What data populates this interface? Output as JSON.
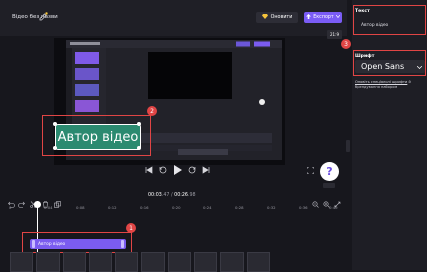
{
  "header": {
    "project_title": "Відео без назви",
    "upgrade_label": "Оновити",
    "export_label": "Експорт"
  },
  "stage": {
    "aspect_ratio": "21:9",
    "overlay_text": "Автор відео"
  },
  "playback": {
    "current_time": "00:03",
    "current_fraction": ".47",
    "separator": " / ",
    "total_time": "00:26",
    "total_fraction": ".98"
  },
  "ruler": {
    "ticks": [
      "0",
      "0:04",
      "0:08",
      "0:12",
      "0:16",
      "0:20",
      "0:24",
      "0:28",
      "0:32",
      "0:36",
      "0:40"
    ]
  },
  "timeline": {
    "clip_label": "Автор відео"
  },
  "sidebar": {
    "text_section_title": "Текст",
    "text_value": "Автор відео",
    "font_section_title": "Шрифт",
    "font_value": "Open Sans",
    "hint_link": "Оновіть спеціальні шрифти",
    "hint_rest": "й брендування набором"
  },
  "callouts": {
    "one": "1",
    "two": "2",
    "three": "3"
  },
  "help": {
    "label": "?"
  },
  "colors": {
    "accent": "#7a5cf5",
    "overlay_card": "#2b8a70",
    "highlight": "#e04545",
    "upgrade_gem": "#f5c33b"
  }
}
